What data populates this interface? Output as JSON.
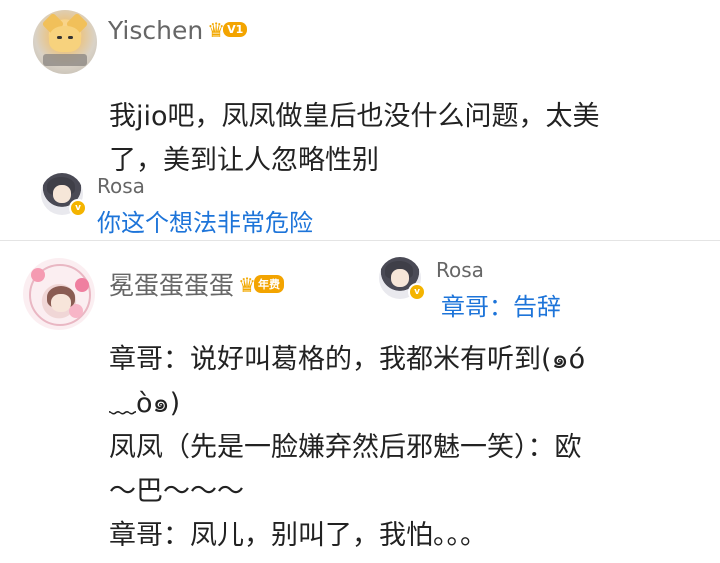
{
  "post1": {
    "username": "Yischen",
    "badge": "V1",
    "body_lines": [
      "我jio吧，凤凤做皇后也没什么问题，太美",
      "了，美到让人忽略性别"
    ]
  },
  "reply1": {
    "username": "Rosa",
    "verify": "v",
    "text": "你这个想法非常危险"
  },
  "post2": {
    "username": "冕蛋蛋蛋蛋",
    "badge": "年费",
    "body_lines": [
      "章哥：说好叫葛格的，我都米有听到(๑ó",
      "﹏ò๑)",
      "凤凤（先是一脸嫌弃然后邪魅一笑）：欧",
      "～巴～～～",
      "章哥：凤儿，别叫了，我怕。。。"
    ]
  },
  "reply2": {
    "username": "Rosa",
    "verify": "v",
    "text": "章哥：告辞"
  },
  "colors": {
    "link_blue": "#1d74d9",
    "vip_gold": "#f3a400"
  }
}
